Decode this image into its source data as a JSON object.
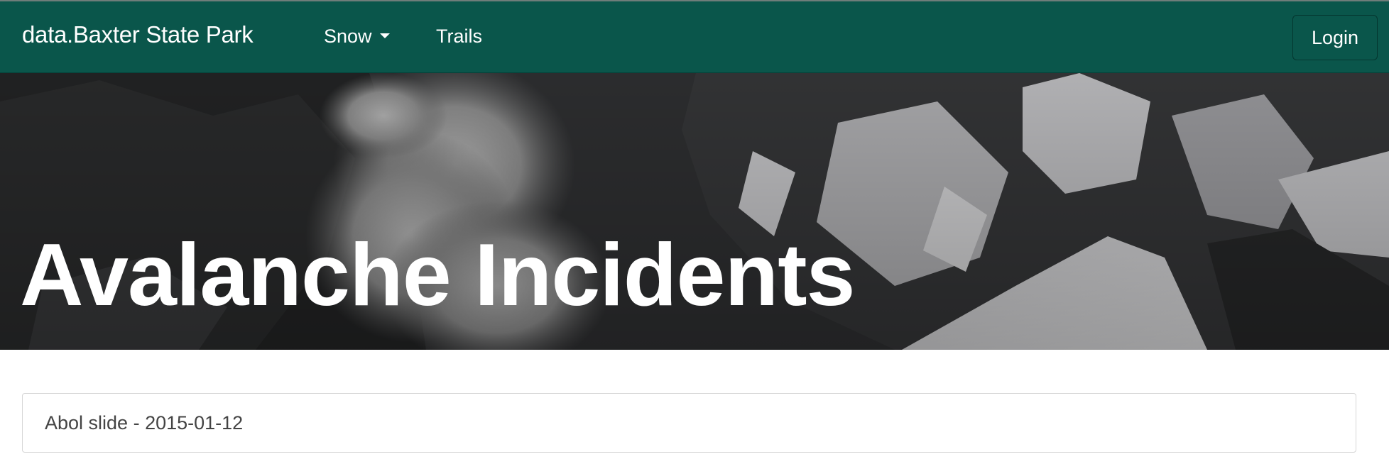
{
  "navbar": {
    "brand": "data.Baxter State Park",
    "items": [
      {
        "label": "Snow",
        "has_dropdown": true
      },
      {
        "label": "Trails",
        "has_dropdown": false
      }
    ],
    "login_label": "Login",
    "background_color": "#0a564b"
  },
  "hero": {
    "title": "Avalanche Incidents",
    "image": "black-and-white photo of an avalanche powder cloud on a snowy mountain face"
  },
  "incidents": [
    {
      "title": "Abol slide - 2015-01-12"
    }
  ],
  "icons": {
    "dropdown": "caret-down-icon"
  }
}
